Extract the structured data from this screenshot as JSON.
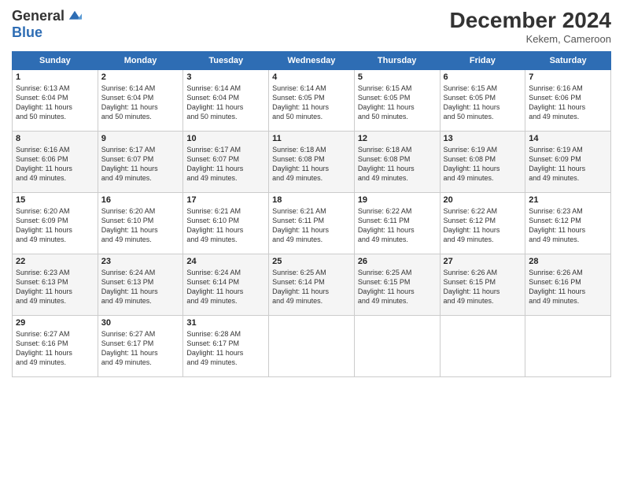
{
  "logo": {
    "general": "General",
    "blue": "Blue"
  },
  "title": "December 2024",
  "location": "Kekem, Cameroon",
  "weekdays": [
    "Sunday",
    "Monday",
    "Tuesday",
    "Wednesday",
    "Thursday",
    "Friday",
    "Saturday"
  ],
  "weeks": [
    [
      {
        "day": "1",
        "sunrise": "6:13 AM",
        "sunset": "6:04 PM",
        "daylight": "11 hours and 50 minutes."
      },
      {
        "day": "2",
        "sunrise": "6:14 AM",
        "sunset": "6:04 PM",
        "daylight": "11 hours and 50 minutes."
      },
      {
        "day": "3",
        "sunrise": "6:14 AM",
        "sunset": "6:04 PM",
        "daylight": "11 hours and 50 minutes."
      },
      {
        "day": "4",
        "sunrise": "6:14 AM",
        "sunset": "6:05 PM",
        "daylight": "11 hours and 50 minutes."
      },
      {
        "day": "5",
        "sunrise": "6:15 AM",
        "sunset": "6:05 PM",
        "daylight": "11 hours and 50 minutes."
      },
      {
        "day": "6",
        "sunrise": "6:15 AM",
        "sunset": "6:05 PM",
        "daylight": "11 hours and 50 minutes."
      },
      {
        "day": "7",
        "sunrise": "6:16 AM",
        "sunset": "6:06 PM",
        "daylight": "11 hours and 49 minutes."
      }
    ],
    [
      {
        "day": "8",
        "sunrise": "6:16 AM",
        "sunset": "6:06 PM",
        "daylight": "11 hours and 49 minutes."
      },
      {
        "day": "9",
        "sunrise": "6:17 AM",
        "sunset": "6:07 PM",
        "daylight": "11 hours and 49 minutes."
      },
      {
        "day": "10",
        "sunrise": "6:17 AM",
        "sunset": "6:07 PM",
        "daylight": "11 hours and 49 minutes."
      },
      {
        "day": "11",
        "sunrise": "6:18 AM",
        "sunset": "6:08 PM",
        "daylight": "11 hours and 49 minutes."
      },
      {
        "day": "12",
        "sunrise": "6:18 AM",
        "sunset": "6:08 PM",
        "daylight": "11 hours and 49 minutes."
      },
      {
        "day": "13",
        "sunrise": "6:19 AM",
        "sunset": "6:08 PM",
        "daylight": "11 hours and 49 minutes."
      },
      {
        "day": "14",
        "sunrise": "6:19 AM",
        "sunset": "6:09 PM",
        "daylight": "11 hours and 49 minutes."
      }
    ],
    [
      {
        "day": "15",
        "sunrise": "6:20 AM",
        "sunset": "6:09 PM",
        "daylight": "11 hours and 49 minutes."
      },
      {
        "day": "16",
        "sunrise": "6:20 AM",
        "sunset": "6:10 PM",
        "daylight": "11 hours and 49 minutes."
      },
      {
        "day": "17",
        "sunrise": "6:21 AM",
        "sunset": "6:10 PM",
        "daylight": "11 hours and 49 minutes."
      },
      {
        "day": "18",
        "sunrise": "6:21 AM",
        "sunset": "6:11 PM",
        "daylight": "11 hours and 49 minutes."
      },
      {
        "day": "19",
        "sunrise": "6:22 AM",
        "sunset": "6:11 PM",
        "daylight": "11 hours and 49 minutes."
      },
      {
        "day": "20",
        "sunrise": "6:22 AM",
        "sunset": "6:12 PM",
        "daylight": "11 hours and 49 minutes."
      },
      {
        "day": "21",
        "sunrise": "6:23 AM",
        "sunset": "6:12 PM",
        "daylight": "11 hours and 49 minutes."
      }
    ],
    [
      {
        "day": "22",
        "sunrise": "6:23 AM",
        "sunset": "6:13 PM",
        "daylight": "11 hours and 49 minutes."
      },
      {
        "day": "23",
        "sunrise": "6:24 AM",
        "sunset": "6:13 PM",
        "daylight": "11 hours and 49 minutes."
      },
      {
        "day": "24",
        "sunrise": "6:24 AM",
        "sunset": "6:14 PM",
        "daylight": "11 hours and 49 minutes."
      },
      {
        "day": "25",
        "sunrise": "6:25 AM",
        "sunset": "6:14 PM",
        "daylight": "11 hours and 49 minutes."
      },
      {
        "day": "26",
        "sunrise": "6:25 AM",
        "sunset": "6:15 PM",
        "daylight": "11 hours and 49 minutes."
      },
      {
        "day": "27",
        "sunrise": "6:26 AM",
        "sunset": "6:15 PM",
        "daylight": "11 hours and 49 minutes."
      },
      {
        "day": "28",
        "sunrise": "6:26 AM",
        "sunset": "6:16 PM",
        "daylight": "11 hours and 49 minutes."
      }
    ],
    [
      {
        "day": "29",
        "sunrise": "6:27 AM",
        "sunset": "6:16 PM",
        "daylight": "11 hours and 49 minutes."
      },
      {
        "day": "30",
        "sunrise": "6:27 AM",
        "sunset": "6:17 PM",
        "daylight": "11 hours and 49 minutes."
      },
      {
        "day": "31",
        "sunrise": "6:28 AM",
        "sunset": "6:17 PM",
        "daylight": "11 hours and 49 minutes."
      },
      null,
      null,
      null,
      null
    ]
  ]
}
